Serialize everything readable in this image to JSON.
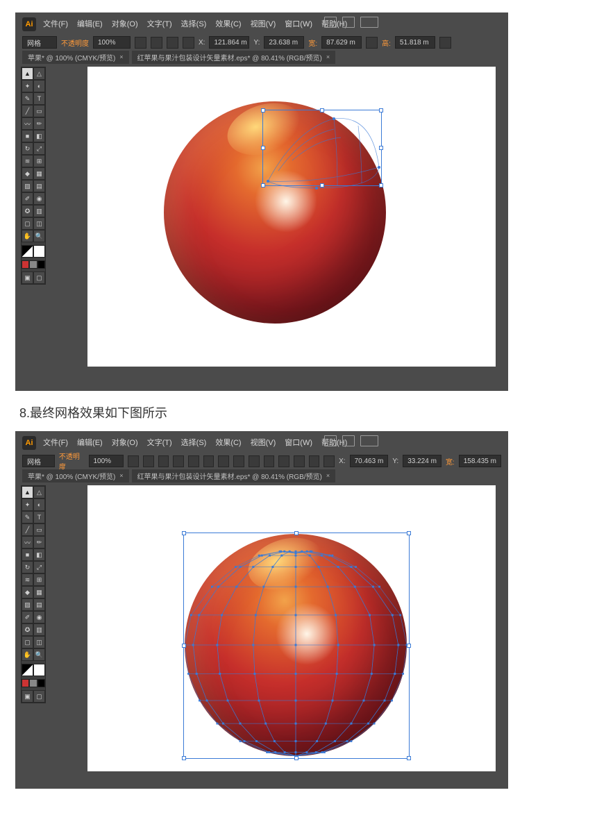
{
  "menus": [
    "文件(F)",
    "编辑(E)",
    "对象(O)",
    "文字(T)",
    "选择(S)",
    "效果(C)",
    "视图(V)",
    "窗口(W)",
    "帮助(H)"
  ],
  "app_badge": "Ai",
  "s1": {
    "ctrl_label": "网格",
    "opacity_label": "不透明度",
    "opacity_val": "100%",
    "x_label": "X:",
    "x_val": "121.864",
    "y_label": "Y:",
    "y_val": "23.638",
    "w_label": "宽:",
    "w_val": "87.629",
    "h_label": "高:",
    "h_val": "51.818",
    "unit": "m",
    "tab1": "苹果* @ 100% (CMYK/预览)",
    "tab2": "红苹果与果汁包装设计矢量素材.eps* @ 80.41% (RGB/预览)"
  },
  "s2": {
    "ctrl_label": "网格",
    "opacity_label": "不透明度",
    "opacity_val": "100%",
    "x_label": "X:",
    "x_val": "70.463",
    "y_label": "Y:",
    "y_val": "33.224",
    "w_label": "宽:",
    "w_val": "158.435",
    "unit": "m",
    "tab1": "苹果* @ 100% (CMYK/预览)",
    "tab2": "红苹果与果汁包装设计矢量素材.eps* @ 80.41% (RGB/预览)"
  },
  "caption": "8.最终网格效果如下图所示"
}
